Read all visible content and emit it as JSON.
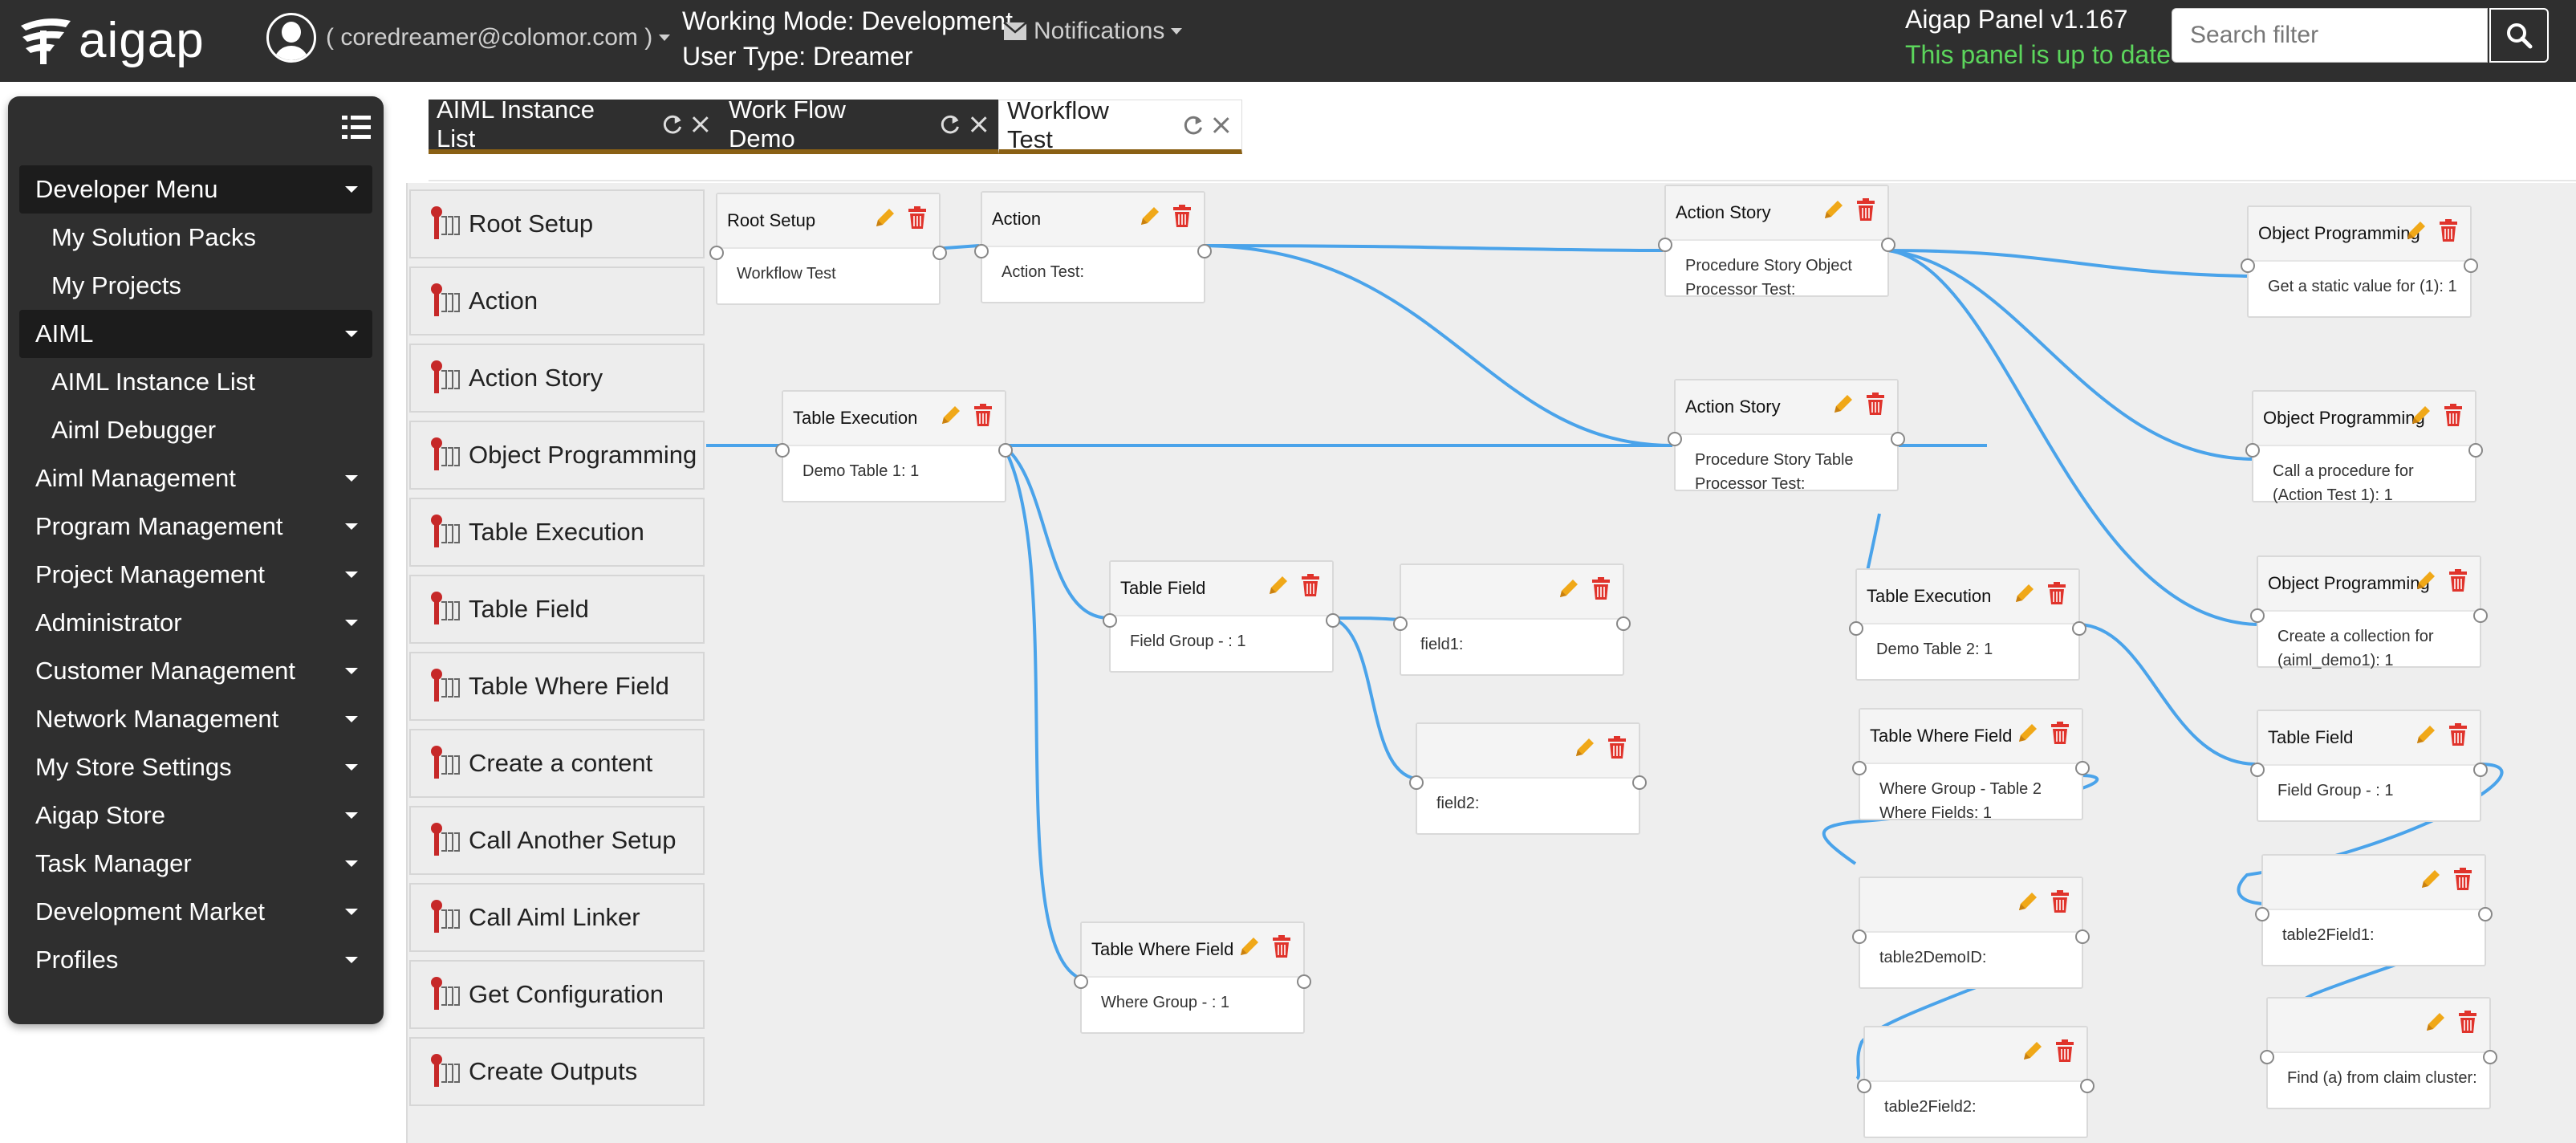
{
  "header": {
    "logo_text": "aigap",
    "user_email": "( coredreamer@colomor.com )",
    "working_mode": "Working Mode: Development",
    "user_type": "User Type: Dreamer",
    "notifications_label": "Notifications",
    "panel_version": "Aigap Panel v1.167",
    "panel_status": "This panel is up to date",
    "search_placeholder": "Search filter"
  },
  "sidebar": {
    "items": [
      {
        "label": "Developer Menu",
        "level": 0,
        "active": true,
        "caret": true
      },
      {
        "label": "My Solution Packs",
        "level": 1,
        "active": false,
        "caret": false
      },
      {
        "label": "My Projects",
        "level": 1,
        "active": false,
        "caret": false
      },
      {
        "label": "AIML",
        "level": 0,
        "active": true,
        "caret": true
      },
      {
        "label": "AIML Instance List",
        "level": 1,
        "active": false,
        "caret": false
      },
      {
        "label": "Aiml Debugger",
        "level": 1,
        "active": false,
        "caret": false
      },
      {
        "label": "Aiml Management",
        "level": 0,
        "active": false,
        "caret": true
      },
      {
        "label": "Program Management",
        "level": 0,
        "active": false,
        "caret": true
      },
      {
        "label": "Project Management",
        "level": 0,
        "active": false,
        "caret": true
      },
      {
        "label": "Administrator",
        "level": 0,
        "active": false,
        "caret": true
      },
      {
        "label": "Customer Management",
        "level": 0,
        "active": false,
        "caret": true
      },
      {
        "label": "Network Management",
        "level": 0,
        "active": false,
        "caret": true
      },
      {
        "label": "My Store Settings",
        "level": 0,
        "active": false,
        "caret": true
      },
      {
        "label": "Aigap Store",
        "level": 0,
        "active": false,
        "caret": true
      },
      {
        "label": "Task Manager",
        "level": 0,
        "active": false,
        "caret": true
      },
      {
        "label": "Development Market",
        "level": 0,
        "active": false,
        "caret": true
      },
      {
        "label": "Profiles",
        "level": 0,
        "active": false,
        "caret": true
      }
    ]
  },
  "tabs": [
    {
      "label": "AIML Instance List",
      "active": false
    },
    {
      "label": "Work Flow Demo",
      "active": false
    },
    {
      "label": "Workflow Test",
      "active": true
    }
  ],
  "palette": [
    "Root Setup",
    "Action",
    "Action Story",
    "Object Programming",
    "Table Execution",
    "Table Field",
    "Table Where Field",
    "Create a content",
    "Call Another Setup",
    "Call Aiml Linker",
    "Get Configuration",
    "Create Outputs"
  ],
  "nodes": {
    "root_setup": {
      "title": "Root Setup",
      "body": "Workflow Test"
    },
    "action": {
      "title": "Action",
      "body": "Action Test:"
    },
    "table_exec_1": {
      "title": "Table Execution",
      "body": "Demo Table 1: 1"
    },
    "table_field_1": {
      "title": "Table Field",
      "body": "Field Group - : 1"
    },
    "field1": {
      "title": "",
      "body": "field1:"
    },
    "field2": {
      "title": "",
      "body": "field2:"
    },
    "table_where_1": {
      "title": "Table Where Field",
      "body": "Where Group - : 1"
    },
    "action_story_1": {
      "title": "Action Story",
      "body": "Procedure Story Object Processor Test:"
    },
    "action_story_2": {
      "title": "Action Story",
      "body": "Procedure Story Table Processor Test:"
    },
    "table_exec_2": {
      "title": "Table Execution",
      "body": "Demo Table 2: 1"
    },
    "table_where_2": {
      "title": "Table Where Field",
      "body": "Where Group - Table 2 Where Fields: 1"
    },
    "table2demoid": {
      "title": "",
      "body": "table2DemoID:"
    },
    "table2field2": {
      "title": "",
      "body": "table2Field2:"
    },
    "obj_prog_1": {
      "title": "Object Programming",
      "body": "Get a static value for (1): 1"
    },
    "obj_prog_2": {
      "title": "Object Programming",
      "body": "Call a procedure for (Action Test 1): 1"
    },
    "obj_prog_3": {
      "title": "Object Programming",
      "body": "Create a collection for (aiml_demo1): 1"
    },
    "table_field_2": {
      "title": "Table Field",
      "body": "Field Group - : 1"
    },
    "table2field1": {
      "title": "",
      "body": "table2Field1:"
    },
    "find_claim": {
      "title": "",
      "body": "Find (a) from claim cluster:"
    }
  },
  "colors": {
    "topbar": "#2f2f2f",
    "link": "#4aa3ea",
    "edit_icon": "#f0a818",
    "delete_icon": "#e0332b",
    "status_ok": "#5cd65c",
    "tab_underline": "#8a6014"
  }
}
